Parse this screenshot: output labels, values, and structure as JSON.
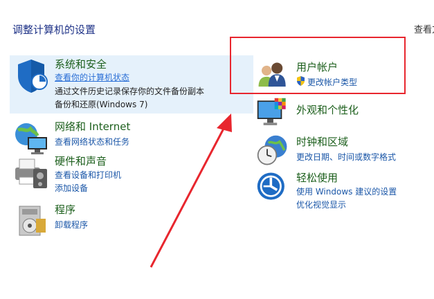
{
  "header": {
    "title": "调整计算机的设置",
    "view_by": "查看方"
  },
  "left": {
    "security": {
      "title": "系统和安全",
      "links": [
        "查看你的计算机状态",
        "通过文件历史记录保存你的文件备份副本",
        "备份和还原(Windows 7)"
      ]
    },
    "network": {
      "title": "网络和 Internet",
      "links": [
        "查看网络状态和任务"
      ]
    },
    "hardware": {
      "title": "硬件和声音",
      "links": [
        "查看设备和打印机",
        "添加设备"
      ]
    },
    "programs": {
      "title": "程序",
      "links": [
        "卸载程序"
      ]
    }
  },
  "right": {
    "accounts": {
      "title": "用户帐户",
      "links": [
        "更改帐户类型"
      ]
    },
    "appearance": {
      "title": "外观和个性化"
    },
    "clock": {
      "title": "时钟和区域",
      "links": [
        "更改日期、时间或数字格式"
      ]
    },
    "ease": {
      "title": "轻松使用",
      "links": [
        "使用 Windows 建议的设置",
        "优化视觉显示"
      ]
    }
  },
  "colors": {
    "annotation_red": "#e8262e",
    "category_title": "#1c5f1c",
    "link": "#1b57a8",
    "selected_bg": "#e5f1fb"
  },
  "icons": [
    "shield-icon",
    "network-icon",
    "printer-icon",
    "programs-icon",
    "users-icon",
    "uac-shield-icon",
    "monitor-icon",
    "clock-icon",
    "ease-of-access-icon"
  ]
}
